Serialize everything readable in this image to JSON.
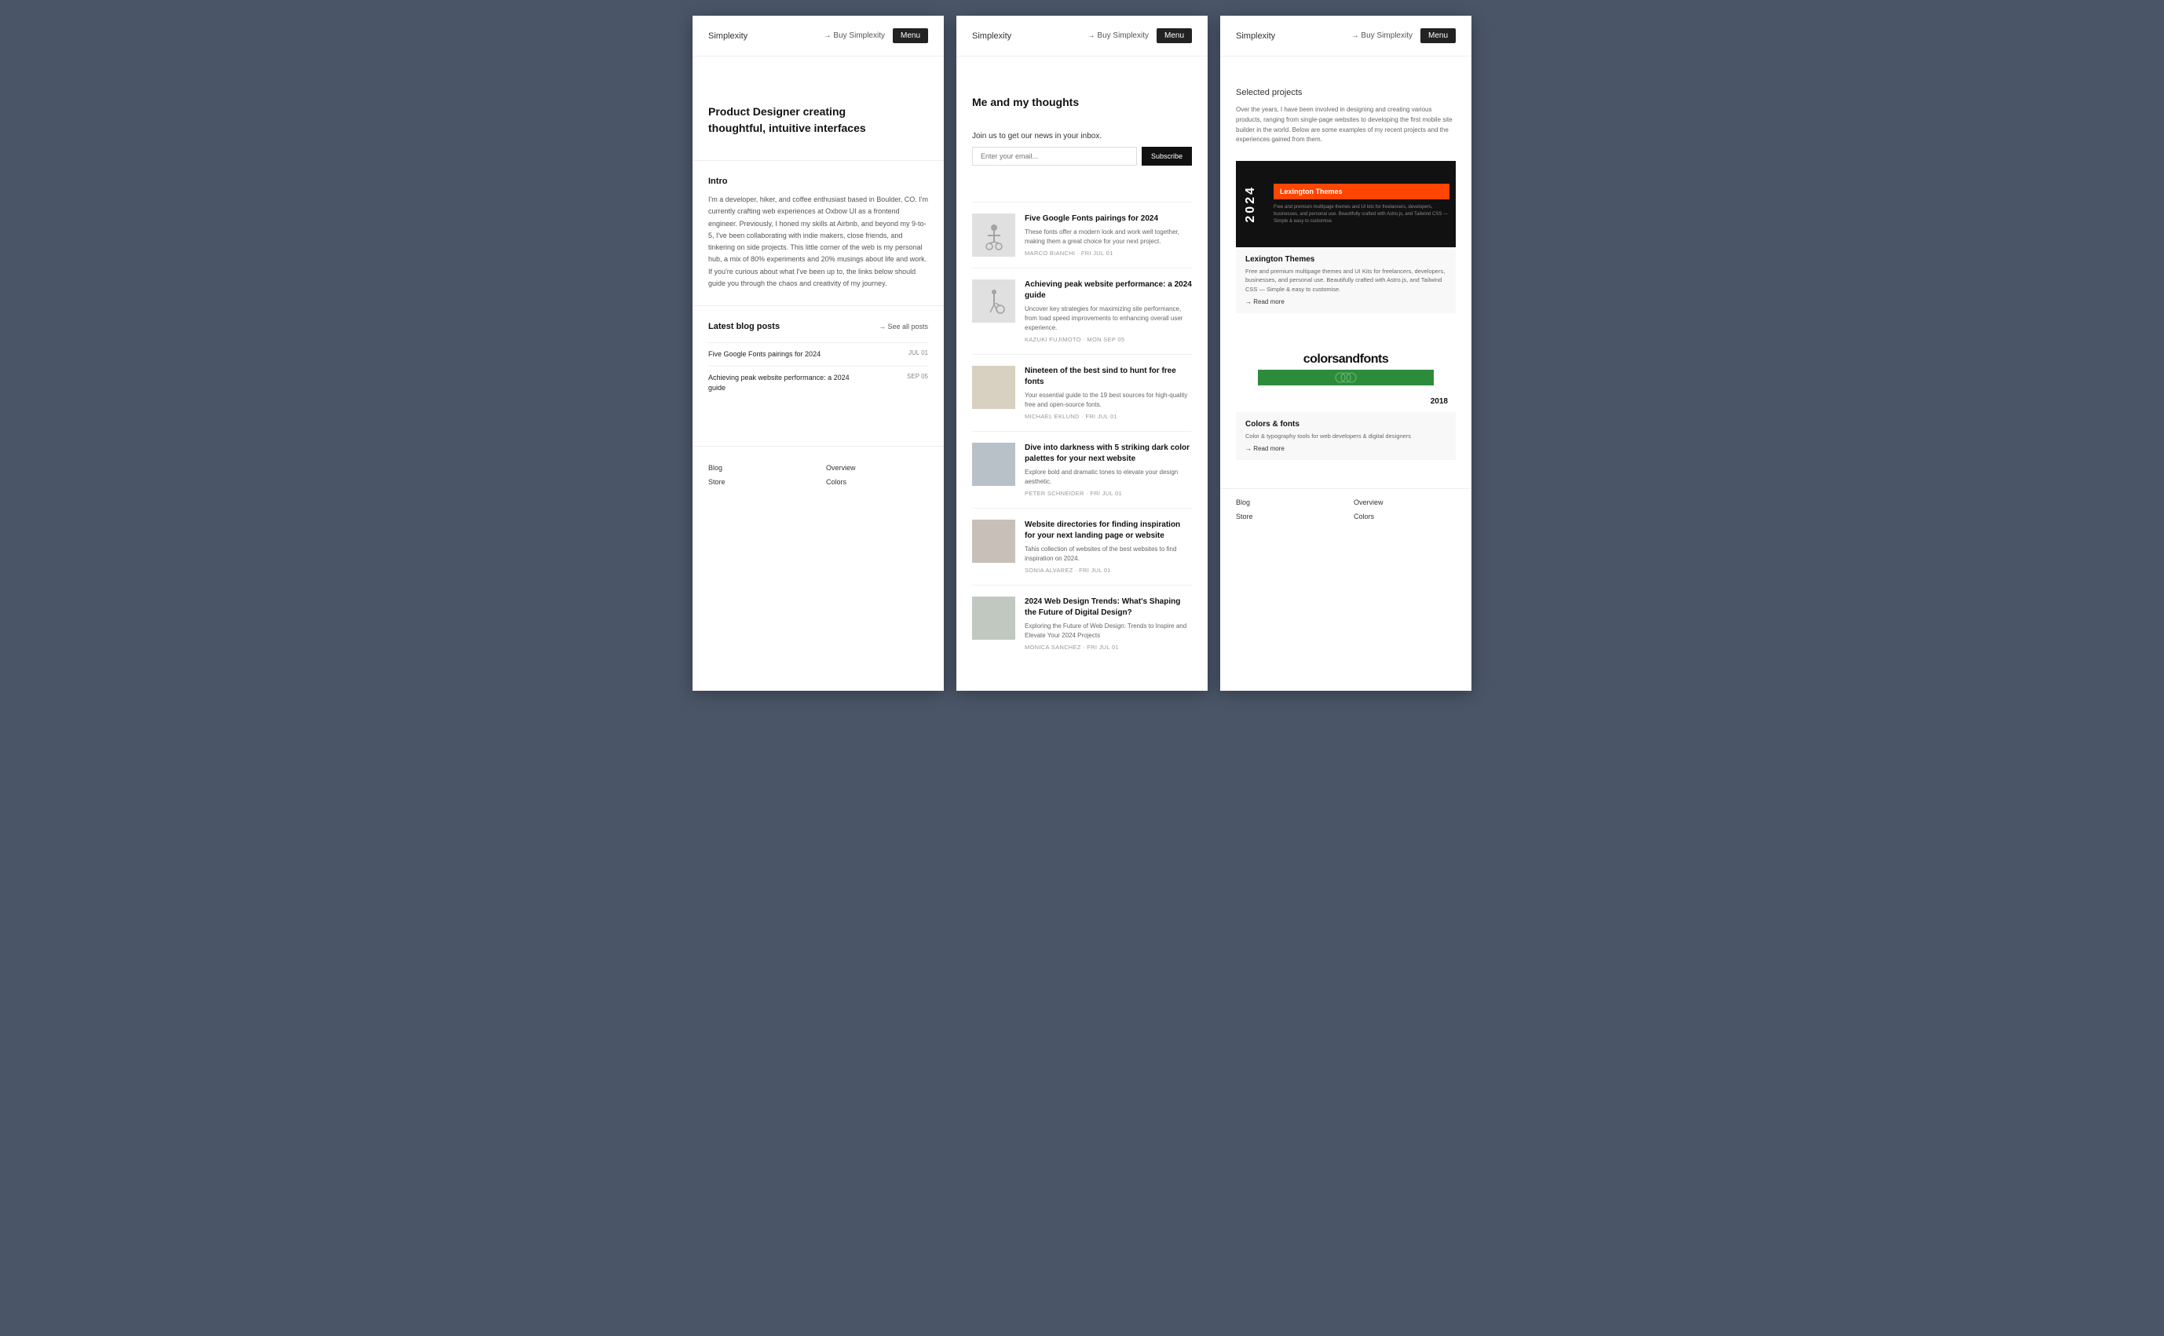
{
  "colors": {
    "accent": "#ff4500",
    "dark": "#111111",
    "text": "#333333",
    "muted": "#666666",
    "light_border": "#eeeeee"
  },
  "panel1": {
    "nav": {
      "logo": "Simplexity",
      "buy_label": "→ Buy Simplexity",
      "menu_label": "Menu"
    },
    "hero": {
      "heading": "Product Designer creating thoughtful, intuitive interfaces"
    },
    "intro": {
      "label": "Intro",
      "text": "I'm a developer, hiker, and coffee enthusiast based in Boulder, CO. I'm currently crafting web experiences at Oxbow UI as a frontend engineer. Previously, I honed my skills at Airbnb, and beyond my 9-to-5, I've been collaborating with indie makers, close friends, and tinkering on side projects. This little corner of the web is my personal hub, a mix of 80% experiments and 20% musings about life and work. If you're curious about what I've been up to, the links below should guide you through the chaos and creativity of my journey."
    },
    "blog": {
      "title": "Latest blog posts",
      "see_all": "→ See all posts",
      "items": [
        {
          "title": "Five Google Fonts pairings for 2024",
          "date": "JUL 01"
        },
        {
          "title": "Achieving peak website performance: a 2024 guide",
          "date": "SEP 05"
        }
      ]
    },
    "footer": {
      "items": [
        {
          "label": "Blog",
          "col": 1
        },
        {
          "label": "Overview",
          "col": 2
        },
        {
          "label": "Store",
          "col": 1
        },
        {
          "label": "Colors",
          "col": 2
        }
      ]
    }
  },
  "panel2": {
    "nav": {
      "logo": "Simplexity",
      "buy_label": "→ Buy Simplexity",
      "menu_label": "Menu"
    },
    "hero": {
      "title": "Me and my thoughts"
    },
    "subscribe": {
      "text": "Join us to get our news in your inbox.",
      "placeholder": "Enter your email...",
      "button": "Subscribe"
    },
    "posts": [
      {
        "title": "Five Google Fonts pairings for 2024",
        "excerpt": "These fonts offer a modern look and work well together, making them a great choice for your next project.",
        "meta": "MARCO BIANCHI · FRI JUL 01",
        "img_type": "person_bike"
      },
      {
        "title": "Achieving peak website performance: a 2024 guide",
        "excerpt": "Uncover key strategies for maximizing site performance, from load speed improvements to enhancing overall user experience.",
        "meta": "KAZUKI FUJIMOTO · MON SEP 05",
        "img_type": "person_walking"
      },
      {
        "title": "Nineteen of the best sind to hunt for free fonts",
        "excerpt": "Your essential guide to the 19 best sources for high-quality free and open-source fonts.",
        "meta": "MICHAEL EKLUND · FRI JUL 01",
        "img_type": "texture"
      },
      {
        "title": "Dive into darkness with 5 striking dark color palettes for your next website",
        "excerpt": "Explore bold and dramatic tones to elevate your design aesthetic.",
        "meta": "PETER SCHNEIDER · FRI JUL 01",
        "img_type": "street"
      },
      {
        "title": "Website directories for finding inspiration for your next landing page or website",
        "excerpt": "Tahis collection of websites of the best websites to find inspiration on 2024.",
        "meta": "SONIA ALVAREZ · FRI JUL 01",
        "img_type": "bike2"
      },
      {
        "title": "2024 Web Design Trends: What's Shaping the Future of Digital Design?",
        "excerpt": "Exploring the Future of Web Design: Trends to Inspire and Elevate Your 2024 Projects",
        "meta": "MONICA SANCHEZ · FRI JUL 01",
        "img_type": "window"
      }
    ]
  },
  "panel3": {
    "nav": {
      "logo": "Simplexity",
      "buy_label": "→ Buy Simplexity",
      "menu_label": "Menu"
    },
    "section_title": "Selected projects",
    "description": "Over the years, I have been involved in designing and creating various products, ranging from single-page websites to developing the first mobile site builder in the world. Below are some examples of my recent projects and the experiences gained from them.",
    "projects": [
      {
        "name": "Lexington Themes",
        "year": "2024",
        "badge": "Lexington Themes",
        "sub_text": "Free and premium multipage themes and UI kits for freelancers, developers, businesses, and personal use. Beautifully crafted with Astro.js, and Tailwind CSS — Simple & easy to customise.",
        "desc": "Free and premium multipage themes and UI Kits for freelancers, developers, businesses, and personal use. Beautifully crafted with Astro.js, and Tailwind CSS — Simple & easy to customise.",
        "link": "→ Read more",
        "type": "lexington"
      },
      {
        "name": "Colors & fonts",
        "year": "2018",
        "desc": "Color & typography tools for web developers & digital designers",
        "link": "→ Read more",
        "type": "colorsandfonts"
      }
    ],
    "footer": {
      "items": [
        {
          "label": "Blog",
          "col": 1
        },
        {
          "label": "Overview",
          "col": 2
        },
        {
          "label": "Store",
          "col": 1
        },
        {
          "label": "Colors",
          "col": 2
        }
      ]
    }
  }
}
